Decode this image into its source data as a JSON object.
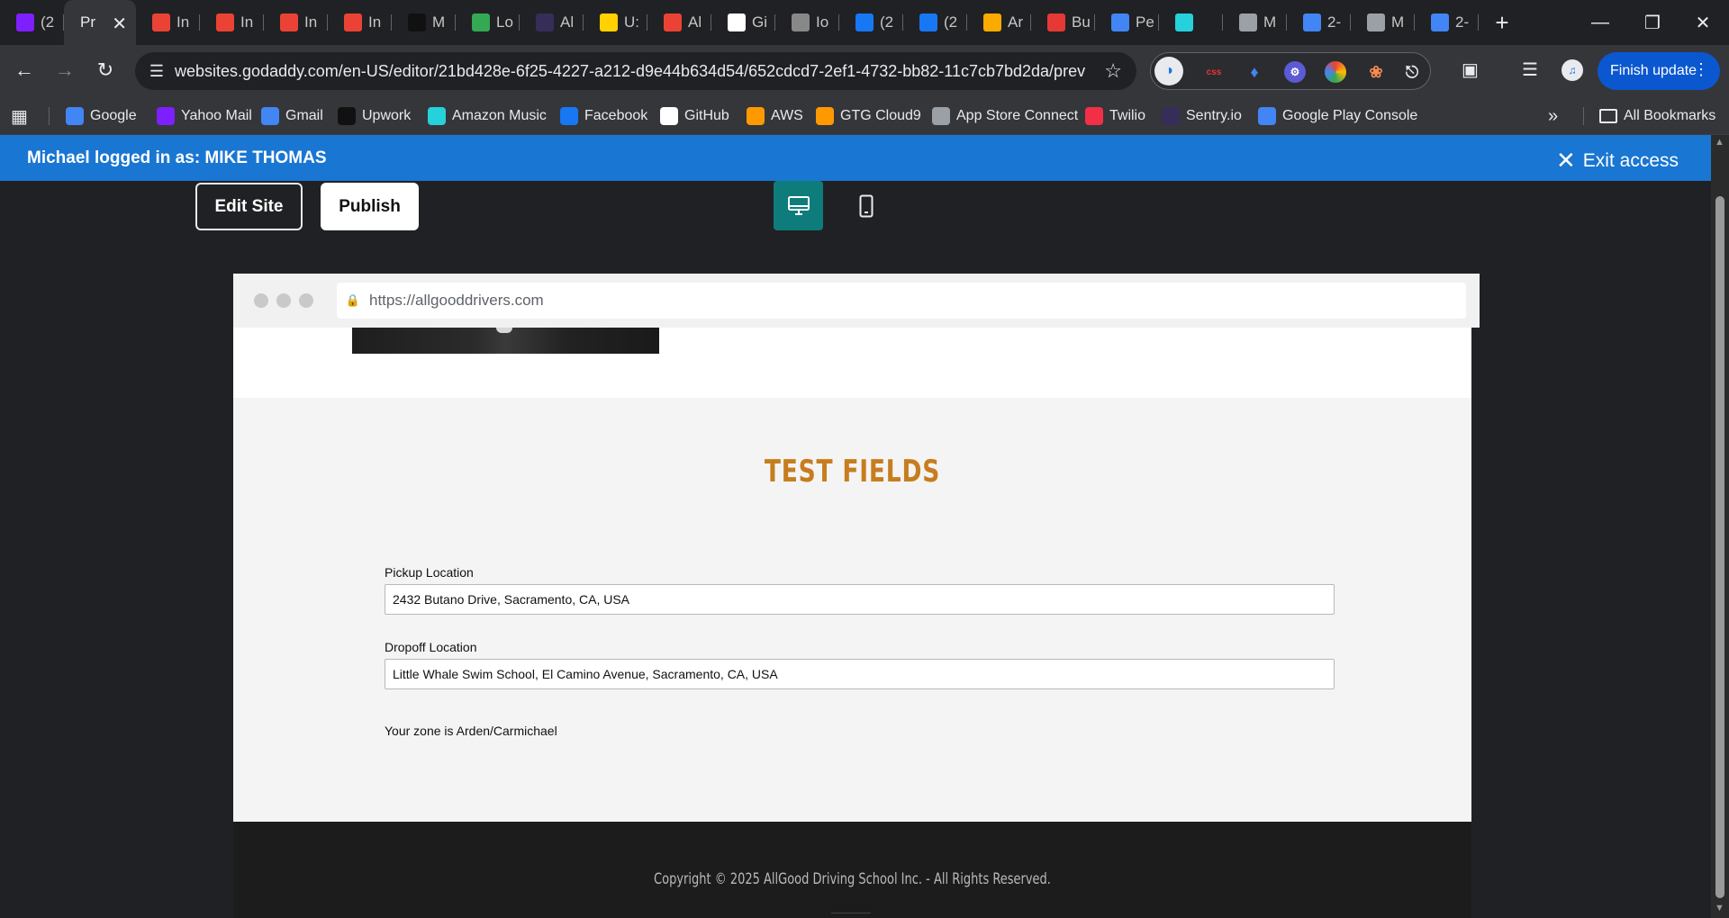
{
  "browser": {
    "tabs": [
      {
        "label": "(2",
        "icon": "yahoo-mail-icon",
        "color": "#7e1fff"
      },
      {
        "label": "Pr",
        "icon": "",
        "color": "",
        "active": true
      },
      {
        "label": "In",
        "icon": "gmail-icon",
        "color": "#ea4335"
      },
      {
        "label": "In",
        "icon": "gmail-icon",
        "color": "#ea4335"
      },
      {
        "label": "In",
        "icon": "gmail-icon",
        "color": "#ea4335"
      },
      {
        "label": "In",
        "icon": "gmail-icon",
        "color": "#ea4335"
      },
      {
        "label": "M",
        "icon": "upwork-icon",
        "color": "#111111"
      },
      {
        "label": "Lo",
        "icon": "check-icon",
        "color": "#34a853"
      },
      {
        "label": "Al",
        "icon": "sentry-icon",
        "color": "#362d59"
      },
      {
        "label": "U:",
        "icon": "norton-icon",
        "color": "#ffd200"
      },
      {
        "label": "Al",
        "icon": "maps-pin-icon",
        "color": "#ea4335"
      },
      {
        "label": "Gi",
        "icon": "github-icon",
        "color": "#ffffff"
      },
      {
        "label": "Io",
        "icon": "wolf-icon",
        "color": "#888888"
      },
      {
        "label": "(2",
        "icon": "facebook-icon",
        "color": "#1877f2"
      },
      {
        "label": "(2",
        "icon": "facebook-icon",
        "color": "#1877f2"
      },
      {
        "label": "Ar",
        "icon": "analytics-icon",
        "color": "#f9ab00"
      },
      {
        "label": "Bu",
        "icon": "badge-icon",
        "color": "#e53935"
      },
      {
        "label": "Pe",
        "icon": "google-ads-icon",
        "color": "#4285f4"
      },
      {
        "label": "",
        "icon": "amazon-music-icon",
        "color": "#25d1da"
      },
      {
        "label": "M",
        "icon": "openai-icon",
        "color": "#9aa0a6"
      },
      {
        "label": "2-",
        "icon": "google-icon",
        "color": "#4285f4"
      },
      {
        "label": "M",
        "icon": "openai-icon",
        "color": "#9aa0a6"
      },
      {
        "label": "2-",
        "icon": "google-icon",
        "color": "#4285f4"
      }
    ],
    "url": "websites.godaddy.com/en-US/editor/21bd428e-6f25-4227-a212-d9e44b634d54/652cdcd7-2ef1-4732-bb82-11c7cb7bd2da/previ...",
    "finish_update_label": "Finish update",
    "bookmarks": [
      {
        "label": "Google",
        "icon": "google-icon",
        "color": "#4285f4"
      },
      {
        "label": "Yahoo Mail",
        "icon": "yahoo-mail-icon",
        "color": "#7e1fff"
      },
      {
        "label": "Gmail",
        "icon": "google-icon",
        "color": "#4285f4"
      },
      {
        "label": "Upwork",
        "icon": "upwork-icon",
        "color": "#111111"
      },
      {
        "label": "Amazon Music",
        "icon": "amazon-music-icon",
        "color": "#25d1da"
      },
      {
        "label": "Facebook",
        "icon": "facebook-icon",
        "color": "#1877f2"
      },
      {
        "label": "GitHub",
        "icon": "github-icon",
        "color": "#ffffff"
      },
      {
        "label": "AWS",
        "icon": "aws-icon",
        "color": "#ff9900"
      },
      {
        "label": "GTG Cloud9",
        "icon": "aws-icon",
        "color": "#ff9900"
      },
      {
        "label": "App Store Connect",
        "icon": "apple-icon",
        "color": "#9aa0a6"
      },
      {
        "label": "Twilio",
        "icon": "twilio-icon",
        "color": "#f22f46"
      },
      {
        "label": "Sentry.io",
        "icon": "sentry-icon",
        "color": "#362d59"
      },
      {
        "label": "Google Play Console",
        "icon": "play-console-icon",
        "color": "#4285f4"
      }
    ],
    "all_bookmarks_label": "All Bookmarks"
  },
  "access_bar": {
    "text": "Michael logged in as: MIKE THOMAS",
    "exit_label": "Exit access"
  },
  "editor": {
    "edit_site_label": "Edit Site",
    "publish_label": "Publish"
  },
  "preview": {
    "url": "https://allgooddrivers.com",
    "section_title": "TEST FIELDS",
    "pickup_label": "Pickup Location",
    "pickup_value": "2432 Butano Drive, Sacramento, CA, USA",
    "dropoff_label": "Dropoff Location",
    "dropoff_value": "Little Whale Swim School, El Camino Avenue, Sacramento, CA, USA",
    "zone_text": "Your zone is Arden/Carmichael",
    "footer_copyright": "Copyright © 2025 AllGood Driving School Inc. - All Rights Reserved."
  },
  "colors": {
    "accent_blue": "#1976d2",
    "title_orange": "#c77d1e",
    "device_active": "#0e7c7b"
  }
}
